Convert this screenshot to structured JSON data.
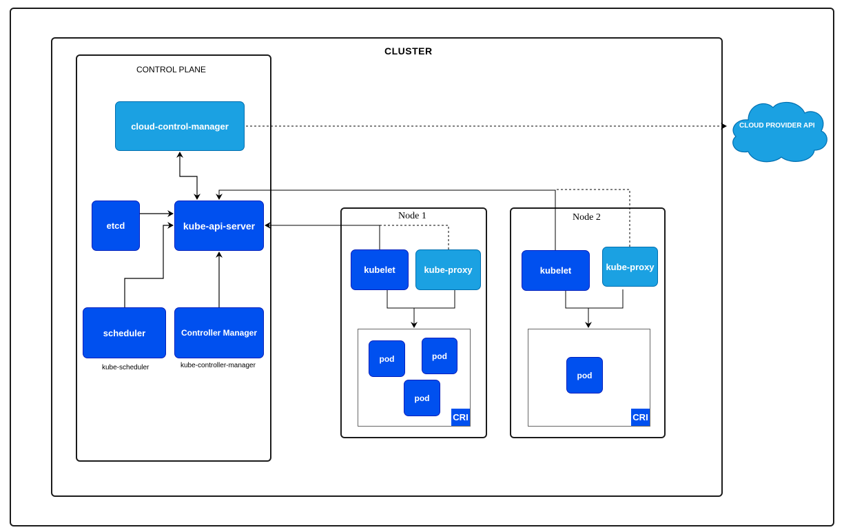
{
  "colors": {
    "primary_component": "#0050ef",
    "secondary_component": "#1ba1e2",
    "cloud": "#1ba1e2",
    "line": "#000000"
  },
  "cluster": {
    "title": "CLUSTER"
  },
  "control_plane": {
    "title": "CONTROL PLANE",
    "components": {
      "cloud_control_manager": "cloud-control-manager",
      "etcd": "etcd",
      "api_server": "kube-api-server",
      "scheduler": "scheduler",
      "scheduler_caption": "kube-scheduler",
      "controller_manager": "Controller Manager",
      "controller_manager_caption": "kube-controller-manager"
    }
  },
  "nodes": [
    {
      "title": "Node 1",
      "kubelet": "kubelet",
      "kube_proxy": "kube-proxy",
      "pods": [
        "pod",
        "pod",
        "pod"
      ],
      "runtime": "CRI"
    },
    {
      "title": "Node 2",
      "kubelet": "kubelet",
      "kube_proxy": "kube-proxy",
      "pods": [
        "pod"
      ],
      "runtime": "CRI"
    }
  ],
  "external": {
    "cloud_provider": "CLOUD PROVIDER API"
  },
  "connections": [
    {
      "from": "cloud-control-manager",
      "to": "kube-api-server",
      "style": "solid",
      "bidirectional": true
    },
    {
      "from": "etcd",
      "to": "kube-api-server",
      "style": "solid"
    },
    {
      "from": "scheduler",
      "to": "kube-api-server",
      "style": "solid"
    },
    {
      "from": "Controller Manager",
      "to": "kube-api-server",
      "style": "solid"
    },
    {
      "from": "cloud-control-manager",
      "to": "CLOUD PROVIDER API",
      "style": "dashed"
    },
    {
      "from": "Node 1 kubelet",
      "to": "kube-api-server",
      "style": "solid"
    },
    {
      "from": "Node 1 kube-proxy",
      "to": "kube-api-server",
      "style": "dashed"
    },
    {
      "from": "Node 2 kubelet",
      "to": "kube-api-server",
      "style": "solid"
    },
    {
      "from": "Node 2 kube-proxy",
      "to": "kube-api-server",
      "style": "dashed"
    },
    {
      "from": "Node 1 kubelet + kube-proxy",
      "to": "Node 1 CRI",
      "style": "solid"
    },
    {
      "from": "Node 2 kubelet + kube-proxy",
      "to": "Node 2 CRI",
      "style": "solid"
    }
  ]
}
